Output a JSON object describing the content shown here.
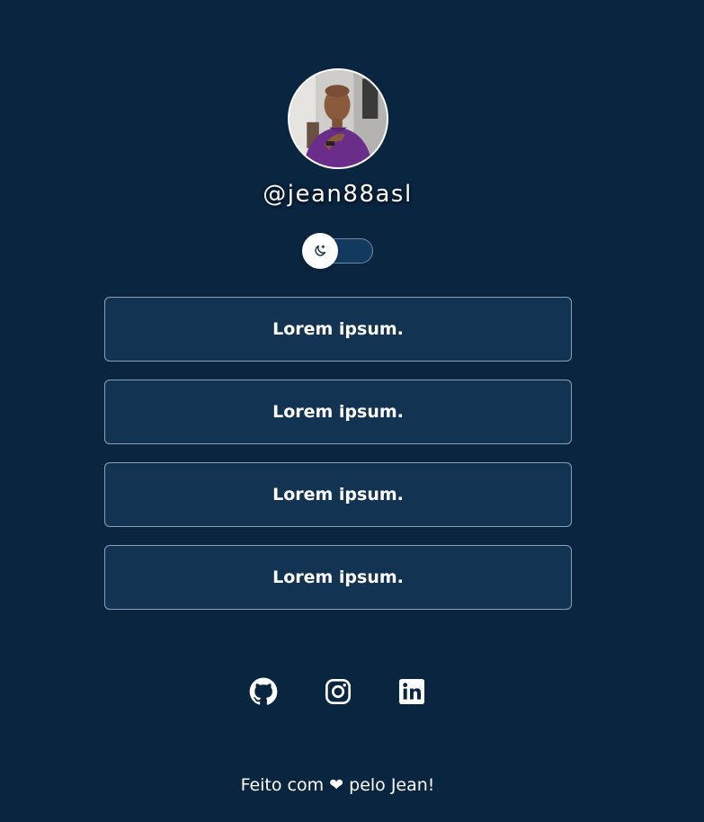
{
  "profile": {
    "handle": "@jean88asl"
  },
  "theme_toggle": {
    "icon": "moon-star-icon",
    "state": "dark"
  },
  "links": [
    {
      "label": "Lorem ipsum."
    },
    {
      "label": "Lorem ipsum."
    },
    {
      "label": "Lorem ipsum."
    },
    {
      "label": "Lorem ipsum."
    }
  ],
  "socials": [
    {
      "icon": "github-icon"
    },
    {
      "icon": "instagram-icon"
    },
    {
      "icon": "linkedin-icon"
    }
  ],
  "footer": {
    "text": "Feito com ❤ pelo Jean!"
  },
  "colors": {
    "background": "#0a2540",
    "button_background": "#123452",
    "button_border": "#8aa0b7",
    "text": "#ffffff"
  }
}
